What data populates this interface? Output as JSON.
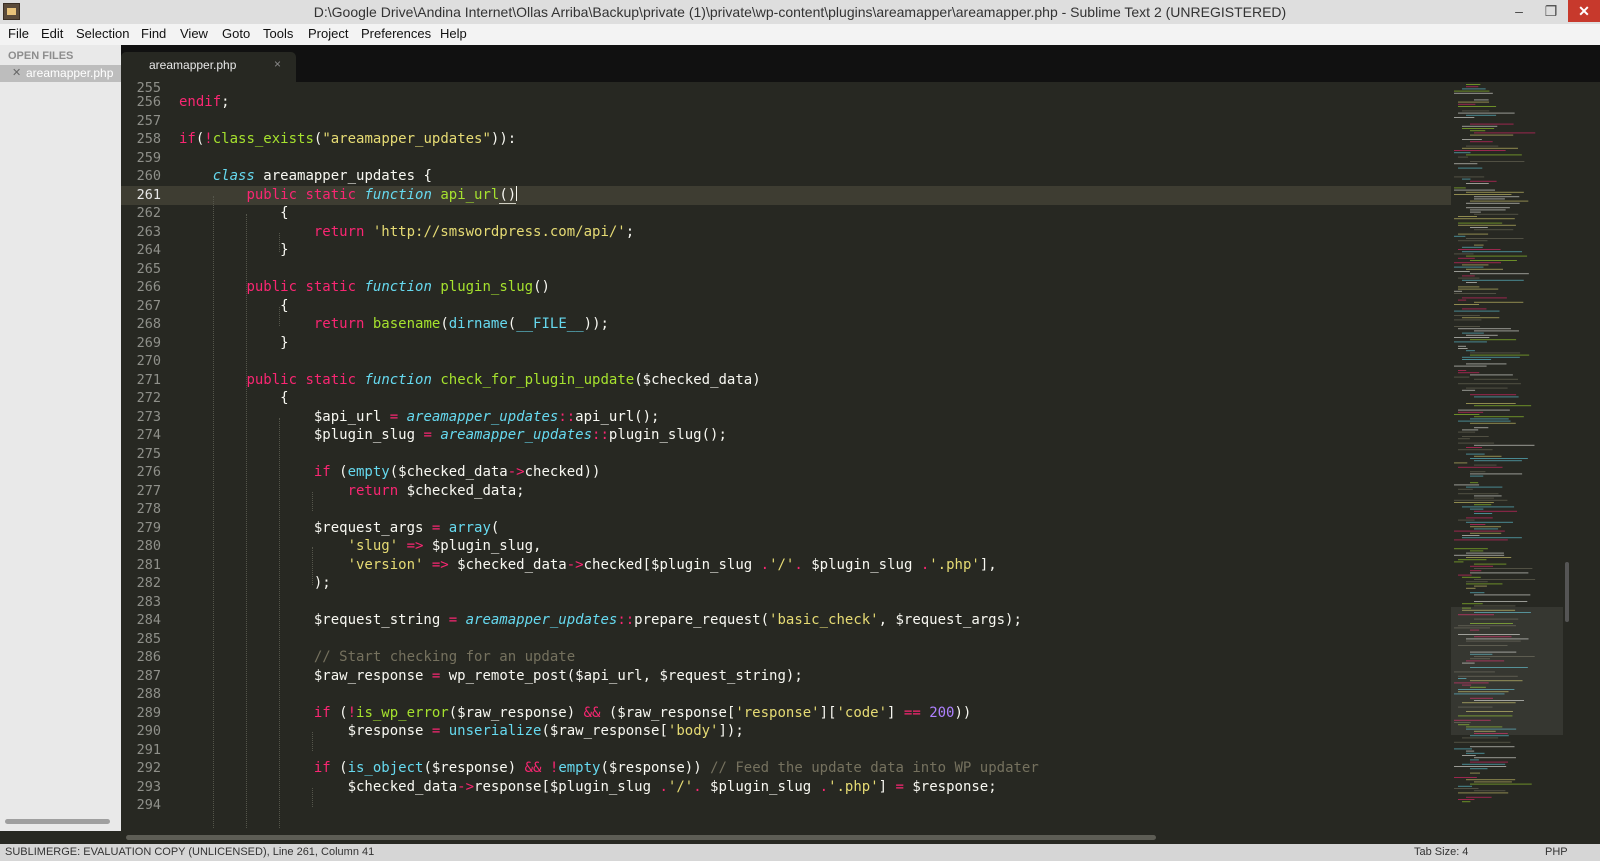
{
  "window": {
    "title": "D:\\Google Drive\\Andina Internet\\Ollas Arriba\\Backup\\private (1)\\private\\wp-content\\plugins\\areamapper\\areamapper.php - Sublime Text 2 (UNREGISTERED)",
    "minimize": "–",
    "maximize": "❐",
    "close": "✕"
  },
  "menu": [
    "File",
    "Edit",
    "Selection",
    "Find",
    "View",
    "Goto",
    "Tools",
    "Project",
    "Preferences",
    "Help"
  ],
  "sidebar": {
    "heading": "OPEN FILES",
    "files": [
      {
        "name": "areamapper.php",
        "close": "✕"
      }
    ]
  },
  "tabs": [
    {
      "label": "areamapper.php",
      "close": "×"
    }
  ],
  "gutter": {
    "partial": "255",
    "lines": [
      "256",
      "257",
      "258",
      "259",
      "260",
      "261",
      "262",
      "263",
      "264",
      "265",
      "266",
      "267",
      "268",
      "269",
      "270",
      "271",
      "272",
      "273",
      "274",
      "275",
      "276",
      "277",
      "278",
      "279",
      "280",
      "281",
      "282",
      "283",
      "284",
      "285",
      "286",
      "287",
      "288",
      "289",
      "290",
      "291",
      "292",
      "293",
      "294"
    ]
  },
  "code_lines": [
    "endif;",
    "",
    "if(!class_exists(\"areamapper_updates\")):",
    "",
    "    class areamapper_updates {",
    "        public static function api_url()",
    "            {",
    "                return 'http://smswordpress.com/api/';",
    "            }",
    "",
    "        public static function plugin_slug()",
    "            {",
    "                return basename(dirname(__FILE__));",
    "            }",
    "",
    "        public static function check_for_plugin_update($checked_data)",
    "            {",
    "                $api_url = areamapper_updates::api_url();",
    "                $plugin_slug = areamapper_updates::plugin_slug();",
    "",
    "                if (empty($checked_data->checked))",
    "                    return $checked_data;",
    "",
    "                $request_args = array(",
    "                    'slug' => $plugin_slug,",
    "                    'version' => $checked_data->checked[$plugin_slug .'/'. $plugin_slug .'.php'],",
    "                );",
    "",
    "                $request_string = areamapper_updates::prepare_request('basic_check', $request_args);",
    "",
    "                // Start checking for an update",
    "                $raw_response = wp_remote_post($api_url, $request_string);",
    "",
    "                if (!is_wp_error($raw_response) && ($raw_response['response']['code'] == 200))",
    "                    $response = unserialize($raw_response['body']);",
    "",
    "                if (is_object($response) && !empty($response)) // Feed the update data into WP updater",
    "                    $checked_data->response[$plugin_slug .'/'. $plugin_slug .'.php'] = $response;",
    ""
  ],
  "status": {
    "left": "SUBLIMERGE: EVALUATION COPY (UNLICENSED), Line 261, Column 41",
    "tab_size": "Tab Size: 4",
    "syntax": "PHP"
  },
  "colors": {
    "background": "#272822",
    "keyword": "#f92672",
    "string": "#e6db74",
    "function": "#a6e22e",
    "storage": "#66d9ef",
    "comment": "#75715e",
    "number": "#ae81ff"
  }
}
